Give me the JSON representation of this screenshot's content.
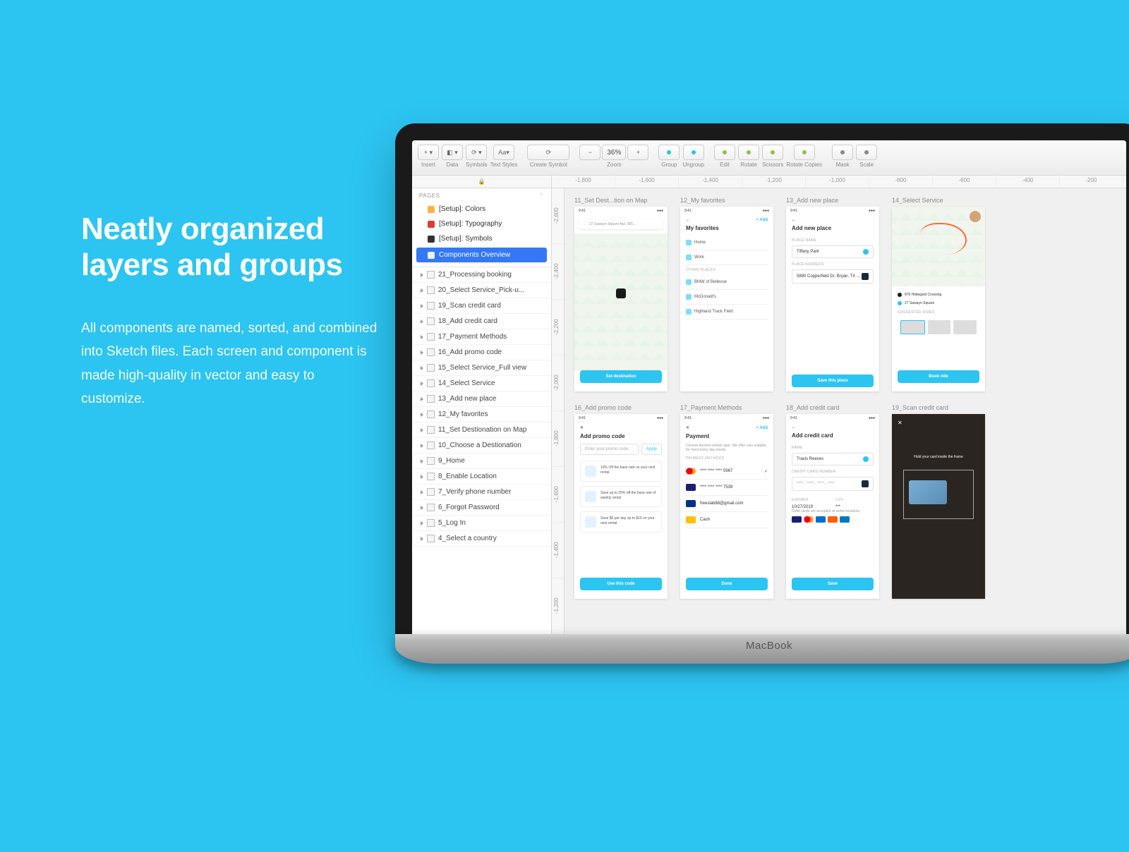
{
  "hero": {
    "title_line1": "Neatly organized",
    "title_line2": "layers and groups",
    "body": "All components are named, sorted, and combined into Sketch files. Each screen and component is made high-quality in vector and easy to customize."
  },
  "macbook": {
    "brand": "MacBook"
  },
  "toolbar": {
    "insert": "Insert",
    "data": "Data",
    "symbols": "Symbols",
    "text_styles": "Text Styles",
    "create_symbol": "Create Symbol",
    "zoom": "Zoom",
    "zoom_value": "36%",
    "group": "Group",
    "ungroup": "Ungroup",
    "edit": "Edit",
    "rotate": "Rotate",
    "scissors": "Scissors",
    "rotate_copies": "Rotate Copies",
    "mask": "Mask",
    "scale": "Scale",
    "aa": "Aa"
  },
  "ruler": {
    "h": [
      "-1,800",
      "-1,600",
      "-1,400",
      "-1,200",
      "-1,000",
      "-800",
      "-600",
      "-400",
      "-200"
    ],
    "v": [
      "-2,600",
      "-2,400",
      "-2,200",
      "-2,000",
      "-1,800",
      "-1,600",
      "-1,400",
      "-1,200"
    ]
  },
  "sidebar": {
    "pages_label": "PAGES",
    "pages": [
      {
        "label": "[Setup]: Colors",
        "ico": "pg-col"
      },
      {
        "label": "[Setup]: Typography",
        "ico": "pg-typ"
      },
      {
        "label": "[Setup]: Symbols",
        "ico": "pg-sym"
      }
    ],
    "selected_page": "Components Overview",
    "layers": [
      "21_Processing booking",
      "20_Select Service_Pick-u...",
      "19_Scan credit card",
      "18_Add credit card",
      "17_Payment Methods",
      "16_Add promo code",
      "15_Select Service_Full view",
      "14_Select Service",
      "13_Add new place",
      "12_My favorites",
      "11_Set Destionation on Map",
      "10_Choose a Destionation",
      "9_Home",
      "8_Enable Location",
      "7_Verify phone number",
      "6_Forgot Password",
      "5_Log In",
      "4_Select a country"
    ]
  },
  "artboards": {
    "r1c1": {
      "title": "11_Set Dest...tion on Map",
      "search": "27 Sawayn Square Apt. 585...",
      "btn": "Set destination"
    },
    "r1c2": {
      "title": "12_My favorites",
      "heading": "My favorites",
      "add": "+ Add",
      "items": [
        "Home",
        "Work"
      ],
      "other_label": "OTHER PLACES",
      "others": [
        "BMW of Bellevue",
        "McDonald's",
        "Highland Track Field"
      ]
    },
    "r1c3": {
      "title": "13_Add new place",
      "heading": "Add new place",
      "label1": "Place name",
      "val1": "Tiffany Park",
      "label2": "Place address",
      "val2": "5890 Copperfield Dr, Bryan, TX ...",
      "btn": "Save this place"
    },
    "r1c4": {
      "title": "14_Select Service",
      "dest1": "876 Hildegard Crossing",
      "dest2": "27 Sawayn Square",
      "suggest": "SUGGESTED RIDES",
      "btn": "Book ride"
    },
    "r2c1": {
      "title": "16_Add promo code",
      "heading": "Add promo code",
      "placeholder": "Enter your promo code",
      "apply": "Apply",
      "p1": "10% Off the base rate on your next rental",
      "p2": "Save up to 20% off the base rate of weekly rental",
      "p3": "Save $5 per day up to $15 on your next rental",
      "btn": "Use this code"
    },
    "r2c2": {
      "title": "17_Payment Methods",
      "heading": "Payment",
      "add": "+ Add",
      "sub": "Choose desired vehicle type. We offer cars suitable for most every day needs.",
      "section": "PAYMENT METHODS",
      "mc": "**** **** **** 5967",
      "visa": "**** **** **** 7539",
      "pp": "freeslab88@gmail.com",
      "cash": "Cash",
      "btn": "Done"
    },
    "r2c3": {
      "title": "18_Add credit card",
      "heading": "Add credit card",
      "name_label": "Name",
      "name": "Travis Reeves",
      "num_label": "Credit card number",
      "num": "**** - **** - **** - ****",
      "exp_label": "Expires",
      "exp": "10/27/2019",
      "cvv_label": "CVV",
      "cvv": "***",
      "note": "Debit cards are accepted at some locations.",
      "btn": "Save"
    },
    "r2c4": {
      "title": "19_Scan credit card",
      "hint": "Hold your card inside the frame"
    }
  }
}
